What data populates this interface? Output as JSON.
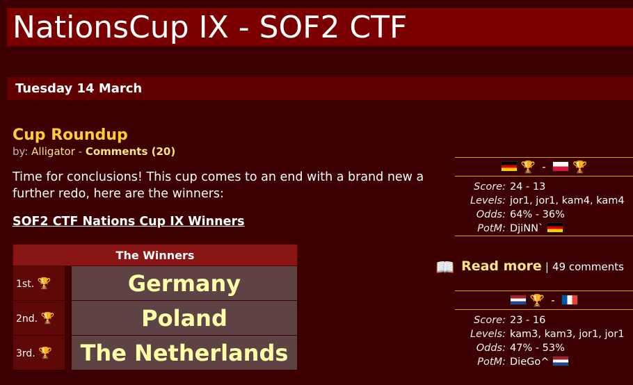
{
  "site": {
    "title": "NationsCup IX - SOF2 CTF"
  },
  "date_header": "Tuesday 14 March",
  "article": {
    "title": "Cup Roundup",
    "by_prefix": "by:",
    "author": "Alligator",
    "separator": "-",
    "comments_link": "Comments (20)",
    "intro": "Time for conclusions! This cup comes to an end with a brand new a further redo, here are the winners:",
    "winners_heading": "SOF2 CTF Nations Cup IX Winners",
    "table": {
      "header": "The Winners",
      "rows": [
        {
          "rank": "1st.",
          "nation": "Germany",
          "trophy": "gold-trophy-icon"
        },
        {
          "rank": "2nd.",
          "nation": "Poland",
          "trophy": "silver-trophy-icon"
        },
        {
          "rank": "3rd.",
          "nation": "The Netherlands",
          "trophy": "bronze-trophy-icon"
        }
      ]
    }
  },
  "matches": [
    {
      "dash": "-",
      "home_flag": "germany-flag",
      "away_flag": "poland-flag",
      "labels": {
        "score": "Score:",
        "levels": "Levels:",
        "odds": "Odds:",
        "potm": "PotM:"
      },
      "score": "24 - 13",
      "levels": "jor1, jor1, kam4, kam4",
      "odds": "64% - 36%",
      "potm": "DjiNN`"
    },
    {
      "dash": "-",
      "home_flag": "netherlands-flag",
      "away_flag": "france-flag",
      "labels": {
        "score": "Score:",
        "levels": "Levels:",
        "odds": "Odds:",
        "potm": "PotM:"
      },
      "score": "23 - 16",
      "levels": "kam3, kam3, jor1, jor1",
      "odds": "47% - 53%",
      "potm": "DieGo^"
    }
  ],
  "read_more": {
    "label": "Read more",
    "separator": "|",
    "comments": "49 comments"
  },
  "colors": {
    "background": "#3c0000",
    "title_bar": "#7a0000",
    "accent": "#ffcc33",
    "nation_text": "#ffffaa"
  }
}
